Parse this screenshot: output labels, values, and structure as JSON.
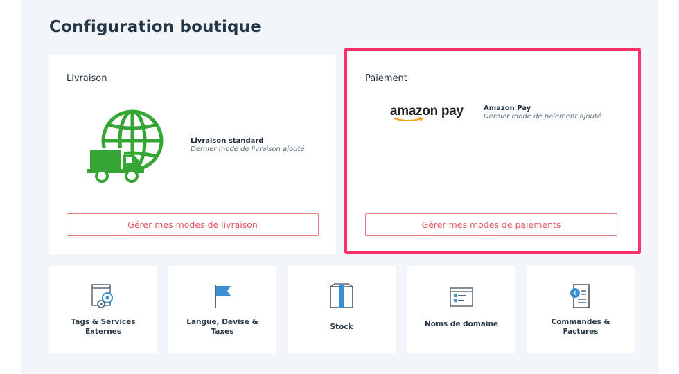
{
  "page": {
    "title": "Configuration boutique"
  },
  "livraison": {
    "title": "Livraison",
    "method_name": "Livraison standard",
    "method_desc": "Dernier mode de livraison ajouté",
    "button": "Gérer mes modes de livraison",
    "icon": "globe-truck-icon"
  },
  "paiement": {
    "title": "Paiement",
    "logo_text": "amazon pay",
    "method_name": "Amazon Pay",
    "method_desc": "Dernier mode de paiement ajouté",
    "button": "Gérer mes modes de paiements"
  },
  "tiles": [
    {
      "label": "Tags & Services Externes",
      "icon": "gears-window-icon"
    },
    {
      "label": "Langue, Devise & Taxes",
      "icon": "flag-icon"
    },
    {
      "label": "Stock",
      "icon": "box-icon"
    },
    {
      "label": "Noms de domaine",
      "icon": "domain-window-icon"
    },
    {
      "label": "Commandes & Factures",
      "icon": "invoice-icon"
    }
  ],
  "colors": {
    "accent": "#e35a5f",
    "highlight": "#ff2f6c",
    "green": "#35a534",
    "blue": "#3a8fd1"
  }
}
